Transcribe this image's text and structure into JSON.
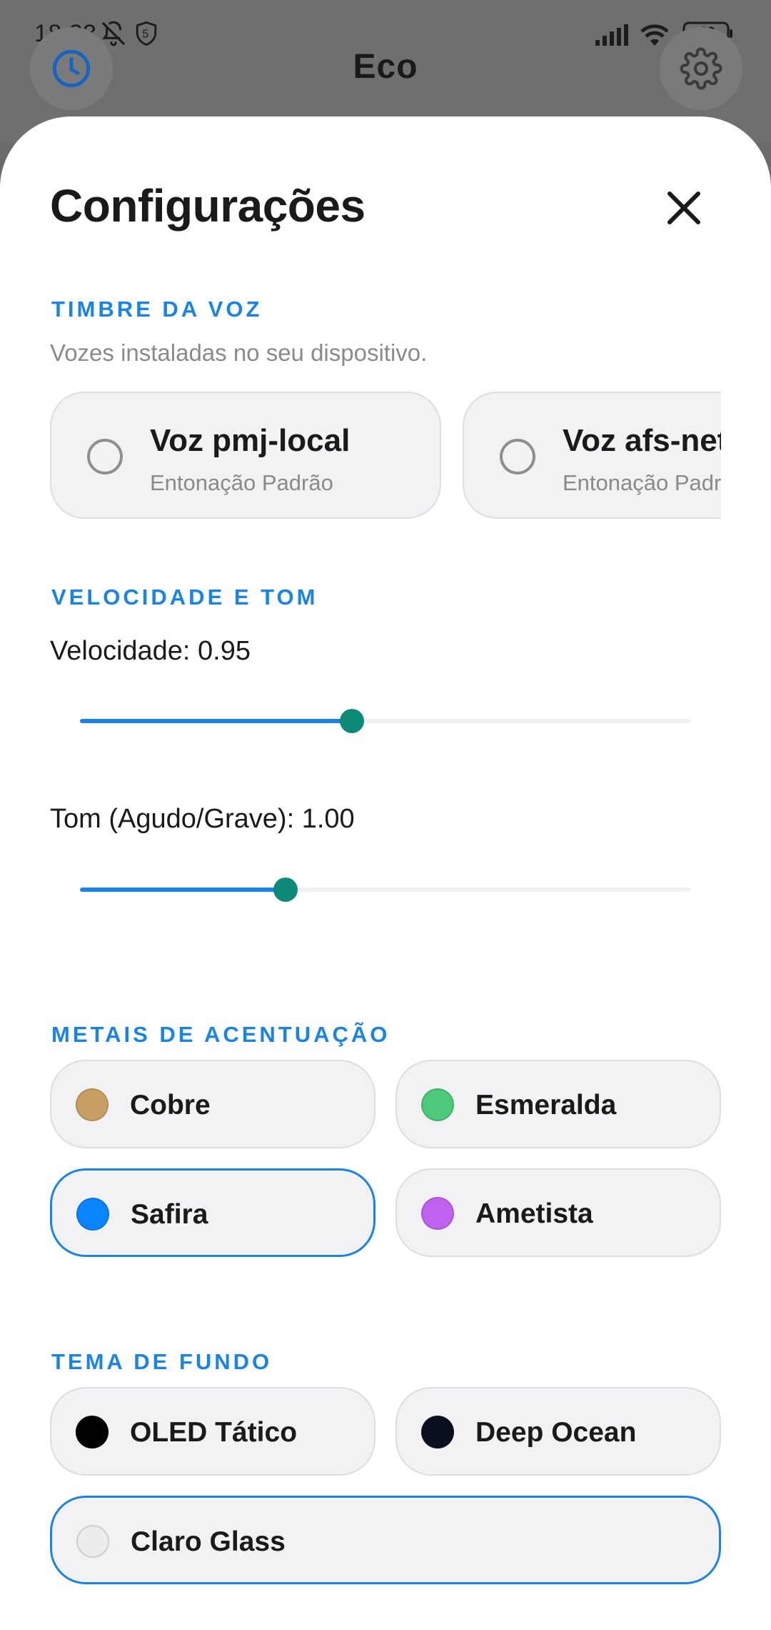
{
  "status_bar": {
    "time": "18:33",
    "battery": "49",
    "icons": [
      "bell-off-icon",
      "shield-icon",
      "signal-icon",
      "wifi-icon",
      "battery-icon"
    ]
  },
  "app_header": {
    "title": "Eco",
    "left_icon": "clock-icon",
    "right_icon": "gear-icon"
  },
  "settings": {
    "title": "Configurações",
    "close_icon": "close-icon",
    "voice_section": {
      "label": "TIMBRE DA VOZ",
      "description": "Vozes instaladas no seu dispositivo.",
      "voices": [
        {
          "name": "Voz pmj-local",
          "subtitle": "Entonação Padrão",
          "selected": false
        },
        {
          "name": "Voz afs-network",
          "subtitle": "Entonação Padrão",
          "selected": false
        }
      ]
    },
    "speed_section": {
      "label": "VELOCIDADE E TOM",
      "speed": {
        "label": "Velocidade: 0.95",
        "value": 0.95,
        "fraction": 0.445
      },
      "pitch": {
        "label": "Tom (Agudo/Grave): 1.00",
        "value": 1.0,
        "fraction": 0.336
      }
    },
    "accent_section": {
      "label": "METAIS DE ACENTUAÇÃO",
      "options": [
        {
          "label": "Cobre",
          "color": "#c9a063",
          "selected": false
        },
        {
          "label": "Esmeralda",
          "color": "#4cc97a",
          "selected": false
        },
        {
          "label": "Safira",
          "color": "#0a84ff",
          "selected": true
        },
        {
          "label": "Ametista",
          "color": "#c062f0",
          "selected": false
        }
      ]
    },
    "theme_section": {
      "label": "TEMA DE FUNDO",
      "options": [
        {
          "label": "OLED Tático",
          "color": "#000000",
          "selected": false
        },
        {
          "label": "Deep Ocean",
          "color": "#0a1020",
          "selected": false
        },
        {
          "label": "Claro Glass",
          "color": "#ececef",
          "selected": true
        }
      ]
    }
  }
}
